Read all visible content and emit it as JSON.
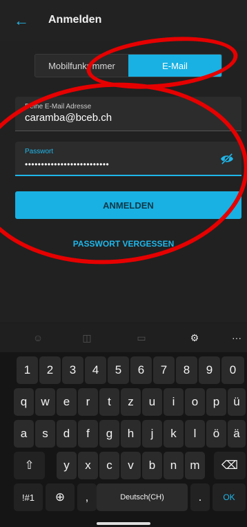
{
  "header": {
    "back_icon": "arrow-left-icon",
    "title": "Anmelden"
  },
  "segment": {
    "left_label": "Mobilfunkr    mmer",
    "right_label": "E-Mail"
  },
  "email": {
    "label": "Deine E-Mail Adresse",
    "value": "caramba@bceb.ch"
  },
  "password": {
    "label": "Passwort",
    "value": "••••••••••••••••••••••••••",
    "toggle_icon": "eye-off-icon"
  },
  "login_button": "ANMELDEN",
  "forgot_link": "PASSWORT VERGESSEN",
  "colors": {
    "accent": "#19b1e3",
    "annotation": "#e60000",
    "background": "#212121"
  },
  "keyboard": {
    "toolbar_icons": [
      "emoji-icon",
      "sticker-icon",
      "gif-icon",
      "settings-icon",
      "more-icon"
    ],
    "toolbar_more": "···",
    "row1": [
      "1",
      "2",
      "3",
      "4",
      "5",
      "6",
      "7",
      "8",
      "9",
      "0"
    ],
    "row2": [
      "q",
      "w",
      "e",
      "r",
      "t",
      "z",
      "u",
      "i",
      "o",
      "p",
      "ü"
    ],
    "row3": [
      "a",
      "s",
      "d",
      "f",
      "g",
      "h",
      "j",
      "k",
      "l",
      "ö",
      "ä"
    ],
    "row4": [
      "y",
      "x",
      "c",
      "v",
      "b",
      "n",
      "m"
    ],
    "shift_icon": "shift-icon",
    "backspace_icon": "backspace-icon",
    "symbols_label": "!#1",
    "globe_icon": "globe-icon",
    "comma": ",",
    "space_label": "Deutsch(CH)",
    "period": ".",
    "ok_label": "OK"
  }
}
